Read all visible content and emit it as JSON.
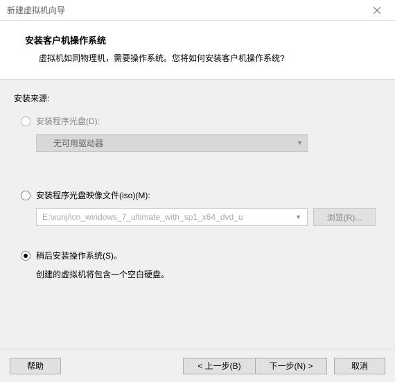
{
  "window": {
    "title": "新建虚拟机向导"
  },
  "header": {
    "title": "安装客户机操作系统",
    "subtitle": "虚拟机如同物理机，需要操作系统。您将如何安装客户机操作系统?"
  },
  "source": {
    "label": "安装来源:",
    "disc": {
      "label": "安装程序光盘(D):",
      "dropdown_value": "无可用驱动器"
    },
    "iso": {
      "label": "安装程序光盘映像文件(iso)(M):",
      "path": "E:\\xunji\\cn_windows_7_ultimate_with_sp1_x64_dvd_u",
      "browse": "浏览(R)..."
    },
    "later": {
      "label": "稍后安装操作系统(S)。",
      "description": "创建的虚拟机将包含一个空白硬盘。"
    }
  },
  "footer": {
    "help": "帮助",
    "back": "< 上一步(B)",
    "next": "下一步(N) >",
    "cancel": "取消"
  }
}
